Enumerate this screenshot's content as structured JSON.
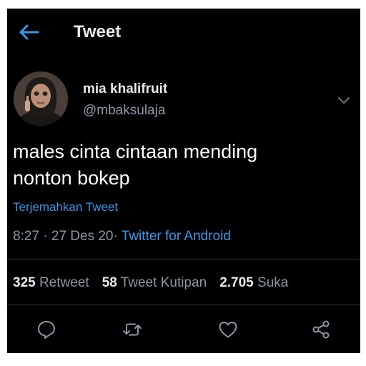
{
  "header": {
    "back_icon": "arrow-left-icon",
    "title": "Tweet"
  },
  "tweet": {
    "author": {
      "display_name": "mia khalifruit",
      "handle": "@mbaksulaja",
      "avatar_icon": "profile-photo"
    },
    "text_line1": "males cinta cintaan mending",
    "text_line2": "nonton bokep",
    "translate_label": "Terjemahkan Tweet",
    "time": "8:27",
    "date": "27 Des 20",
    "separator": "·",
    "source": "Twitter for Android"
  },
  "stats": {
    "retweets": {
      "count": "325",
      "label": "Retweet"
    },
    "quotes": {
      "count": "58",
      "label": "Tweet Kutipan"
    },
    "likes": {
      "count": "2.705",
      "label": "Suka"
    }
  },
  "actions": [
    "reply-icon",
    "retweet-icon",
    "like-icon",
    "share-icon"
  ],
  "colors": {
    "background": "#000000",
    "link": "#3c95e6",
    "text_primary": "#e7e9ea",
    "text_secondary": "#8b98a5",
    "divider": "#2f3336"
  }
}
